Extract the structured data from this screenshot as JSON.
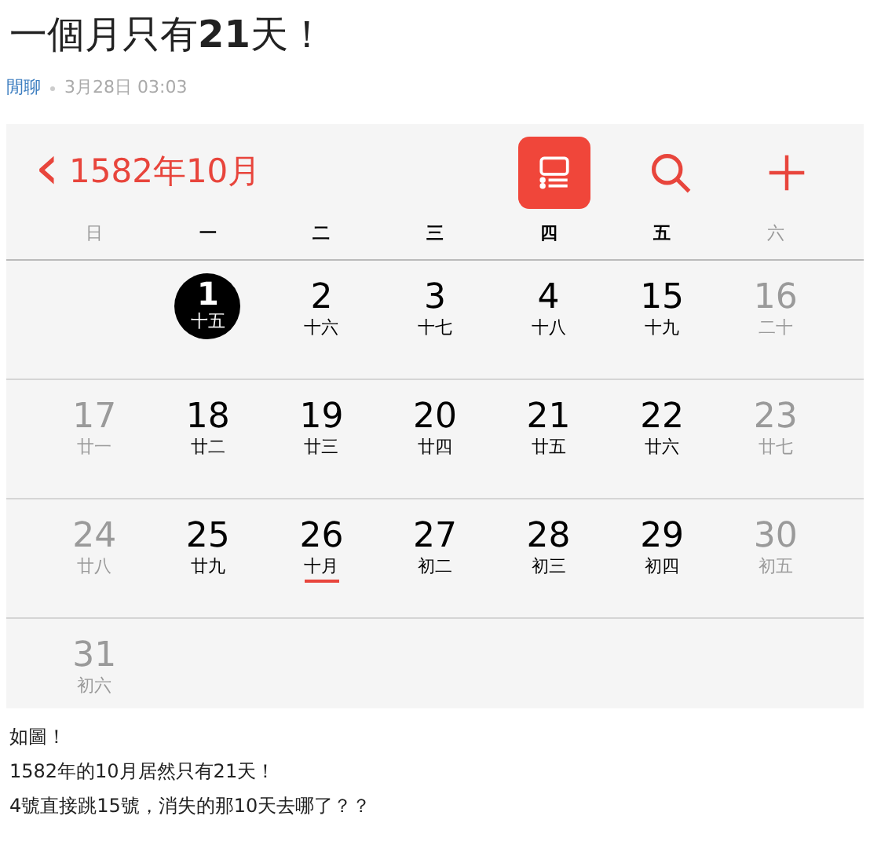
{
  "post": {
    "title": "一個月只有**21**天！",
    "board": "閒聊",
    "date": "3月28日 03:03"
  },
  "calendar": {
    "back": "‹",
    "month_title": "1582年10月",
    "toolbar": [
      {
        "kind": "list",
        "selected": true
      },
      {
        "kind": "search",
        "selected": false
      },
      {
        "kind": "add",
        "selected": false
      }
    ],
    "weekdays": [
      {
        "label": "日",
        "weekend": true
      },
      {
        "label": "一",
        "weekend": false
      },
      {
        "label": "二",
        "weekend": false
      },
      {
        "label": "三",
        "weekend": false
      },
      {
        "label": "四",
        "weekend": false
      },
      {
        "label": "五",
        "weekend": false
      },
      {
        "label": "六",
        "weekend": true
      }
    ],
    "weeks": [
      [
        {
          "kind": "blank"
        },
        {
          "kind": "day",
          "day": "1",
          "lunar": "十五",
          "weekend": false,
          "selected": true,
          "marked": false
        },
        {
          "kind": "day",
          "day": "2",
          "lunar": "十六",
          "weekend": false,
          "selected": false,
          "marked": false
        },
        {
          "kind": "day",
          "day": "3",
          "lunar": "十七",
          "weekend": false,
          "selected": false,
          "marked": false
        },
        {
          "kind": "day",
          "day": "4",
          "lunar": "十八",
          "weekend": false,
          "selected": false,
          "marked": false
        },
        {
          "kind": "day",
          "day": "15",
          "lunar": "十九",
          "weekend": false,
          "selected": false,
          "marked": false
        },
        {
          "kind": "day",
          "day": "16",
          "lunar": "二十",
          "weekend": true,
          "selected": false,
          "marked": false
        }
      ],
      [
        {
          "kind": "day",
          "day": "17",
          "lunar": "廿一",
          "weekend": true,
          "selected": false,
          "marked": false
        },
        {
          "kind": "day",
          "day": "18",
          "lunar": "廿二",
          "weekend": false,
          "selected": false,
          "marked": false
        },
        {
          "kind": "day",
          "day": "19",
          "lunar": "廿三",
          "weekend": false,
          "selected": false,
          "marked": false
        },
        {
          "kind": "day",
          "day": "20",
          "lunar": "廿四",
          "weekend": false,
          "selected": false,
          "marked": false
        },
        {
          "kind": "day",
          "day": "21",
          "lunar": "廿五",
          "weekend": false,
          "selected": false,
          "marked": false
        },
        {
          "kind": "day",
          "day": "22",
          "lunar": "廿六",
          "weekend": false,
          "selected": false,
          "marked": false
        },
        {
          "kind": "day",
          "day": "23",
          "lunar": "廿七",
          "weekend": true,
          "selected": false,
          "marked": false
        }
      ],
      [
        {
          "kind": "day",
          "day": "24",
          "lunar": "廿八",
          "weekend": true,
          "selected": false,
          "marked": false
        },
        {
          "kind": "day",
          "day": "25",
          "lunar": "廿九",
          "weekend": false,
          "selected": false,
          "marked": false
        },
        {
          "kind": "day",
          "day": "26",
          "lunar": "十月",
          "weekend": false,
          "selected": false,
          "marked": true
        },
        {
          "kind": "day",
          "day": "27",
          "lunar": "初二",
          "weekend": false,
          "selected": false,
          "marked": false
        },
        {
          "kind": "day",
          "day": "28",
          "lunar": "初三",
          "weekend": false,
          "selected": false,
          "marked": false
        },
        {
          "kind": "day",
          "day": "29",
          "lunar": "初四",
          "weekend": false,
          "selected": false,
          "marked": false
        },
        {
          "kind": "day",
          "day": "30",
          "lunar": "初五",
          "weekend": true,
          "selected": false,
          "marked": false
        }
      ],
      [
        {
          "kind": "day",
          "day": "31",
          "lunar": "初六",
          "weekend": true,
          "selected": false,
          "marked": false
        }
      ]
    ]
  },
  "body": [
    "如圖！",
    "1582年的10月居然只有21天！",
    "4號直接跳15號，消失的那10天去哪了？？"
  ]
}
